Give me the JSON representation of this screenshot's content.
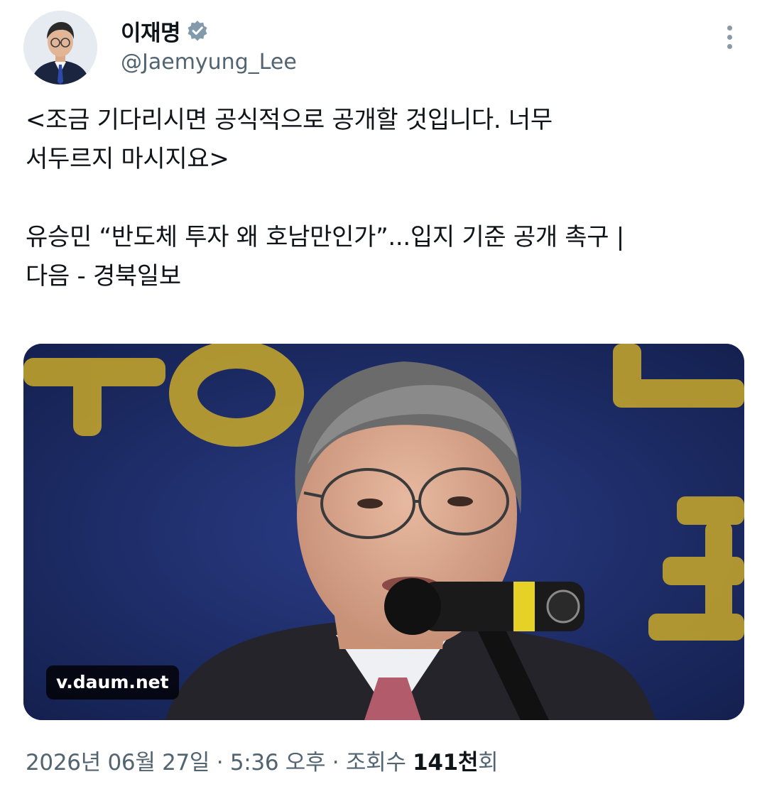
{
  "author": {
    "display_name": "이재명",
    "handle": "@Jaemyung_Lee",
    "verified": true,
    "avatar": "profile-photo",
    "verified_color": "#829aab"
  },
  "tweet": {
    "lines": [
      "<조금 기다리시면 공식적으로 공개할 것입니다. 너무",
      "서두르지 마시지요>",
      "유승민 “반도체 투자 왜 호남만인가”...입지 기준 공개 촉구 |",
      "다음 - 경북일보"
    ]
  },
  "card": {
    "domain": "v.daum.net",
    "image": "press-conference-photo"
  },
  "meta": {
    "date": "2026년 06월 27일",
    "separator1": " · ",
    "time": "5:36 오후",
    "separator2": " · ",
    "views_label": "조회수 ",
    "views_count": "141천",
    "views_suffix": "회"
  },
  "icons": {
    "more": "more-vertical-icon",
    "verified": "verified-badge-icon"
  }
}
